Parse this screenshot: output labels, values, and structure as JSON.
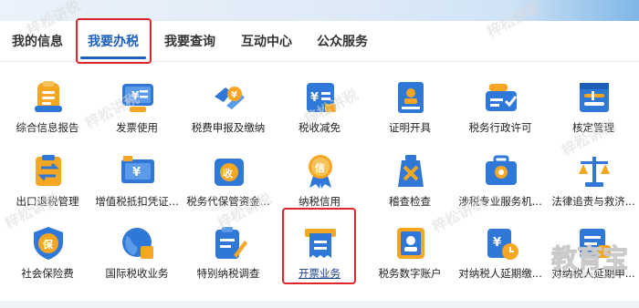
{
  "tabs": [
    {
      "label": "我的信息"
    },
    {
      "label": "我要办税"
    },
    {
      "label": "我要查询"
    },
    {
      "label": "互动中心"
    },
    {
      "label": "公众服务"
    }
  ],
  "active_tab": "我要办税",
  "items": [
    {
      "label": "综合信息报告",
      "icon": "report-icon"
    },
    {
      "label": "发票使用",
      "icon": "invoice-icon"
    },
    {
      "label": "税费申报及缴纳",
      "icon": "tax-payment-icon"
    },
    {
      "label": "税收减免",
      "icon": "tax-relief-icon"
    },
    {
      "label": "证明开具",
      "icon": "certificate-icon"
    },
    {
      "label": "税务行政许可",
      "icon": "admin-permit-icon"
    },
    {
      "label": "核定管理",
      "icon": "assessment-icon"
    },
    {
      "label": "出口退税管理",
      "icon": "export-refund-icon"
    },
    {
      "label": "增值税抵扣凭证...",
      "icon": "vat-deduction-icon"
    },
    {
      "label": "税务代保管资金...",
      "icon": "custody-funds-icon"
    },
    {
      "label": "纳税信用",
      "icon": "tax-credit-icon"
    },
    {
      "label": "稽查检查",
      "icon": "inspection-icon"
    },
    {
      "label": "涉税专业服务机...",
      "icon": "professional-service-icon"
    },
    {
      "label": "法律追责与救济...",
      "icon": "legal-scale-icon"
    },
    {
      "label": "社会保险费",
      "icon": "social-insurance-icon"
    },
    {
      "label": "国际税收业务",
      "icon": "international-tax-icon"
    },
    {
      "label": "特别纳税调查",
      "icon": "special-investigation-icon"
    },
    {
      "label": "开票业务",
      "icon": "invoicing-icon"
    },
    {
      "label": "税务数字账户",
      "icon": "digital-account-icon"
    },
    {
      "label": "对纳税人延期缴...",
      "icon": "deferral-icon"
    },
    {
      "label": "对纳税人延期申...",
      "icon": "deferral-declare-icon"
    }
  ],
  "watermark": {
    "text": "梓松讲税",
    "corner_logo": "教育宝",
    "corner_sub": "JIAOYUBAO.CN"
  },
  "colors": {
    "accent": "#1f5fbf",
    "highlight_border": "#e0262b",
    "icon_orange": "#f5a623",
    "icon_blue": "#2f78d8"
  }
}
